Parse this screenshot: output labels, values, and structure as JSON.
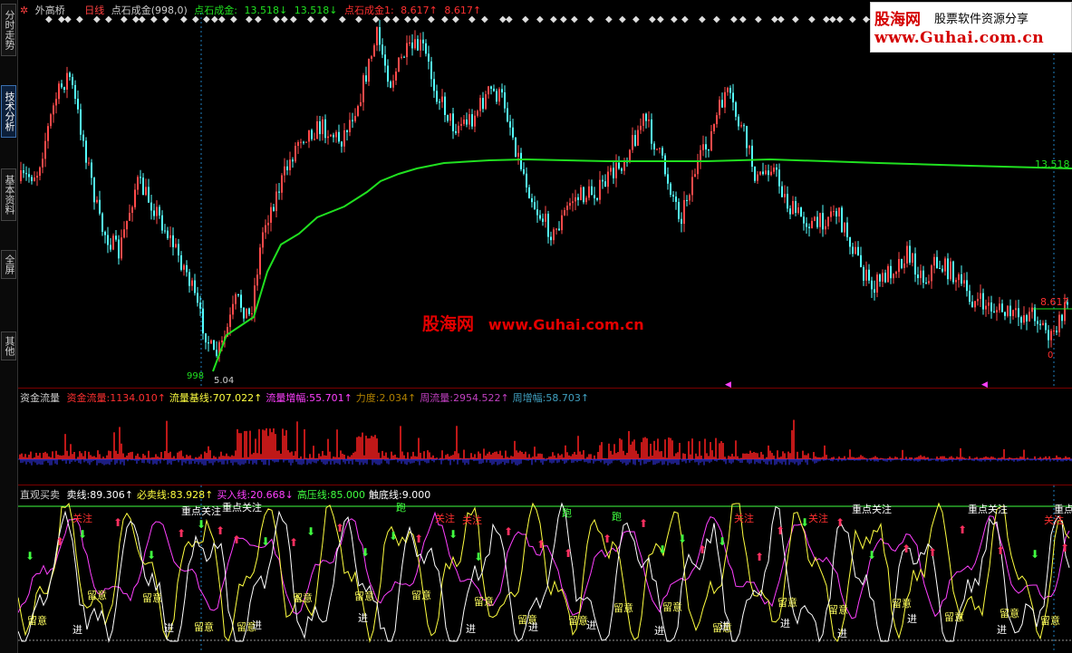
{
  "sidebar": {
    "tabs": [
      {
        "label": "分时走势"
      },
      {
        "label": "技术分析"
      },
      {
        "label": "基本资料"
      },
      {
        "label": "全屏"
      },
      {
        "label": "其他"
      }
    ]
  },
  "main_pane": {
    "stock_name": "外高桥",
    "period": "日线",
    "indicator": "点石成金(998,0)",
    "line1_label": "点石成金:",
    "line1_value": "13.518↓",
    "line1_value2": "13.518↓",
    "line2_label": "点石成金1:",
    "line2_value": "8.617↑",
    "line2_value2": "8.617↑",
    "right_label_ma": "13.518",
    "right_label_low": "8.617",
    "low_point_label": "5.04",
    "low_point_tag": "998",
    "right_zero": "0"
  },
  "flow_pane": {
    "title": "资金流量",
    "items": [
      {
        "label": "资金流量:",
        "value": "1134.010↑",
        "color": "#ff3030"
      },
      {
        "label": "流量基线:",
        "value": "707.022↑",
        "color": "#ffff40"
      },
      {
        "label": "流量增幅:",
        "value": "55.701↑",
        "color": "#ff40ff"
      },
      {
        "label": "力度:",
        "value": "2.034↑",
        "color": "#b08000"
      },
      {
        "label": "周流量:",
        "value": "2954.522↑",
        "color": "#c040c0"
      },
      {
        "label": "周增幅:",
        "value": "58.703↑",
        "color": "#40a0c0"
      }
    ]
  },
  "trade_pane": {
    "title": "直观买卖",
    "items": [
      {
        "label": "卖线:",
        "value": "89.306↑",
        "color": "#ffffff"
      },
      {
        "label": "必卖线:",
        "value": "83.928↑",
        "color": "#ffff40"
      },
      {
        "label": "买入线:",
        "value": "20.668↓",
        "color": "#ff40ff"
      },
      {
        "label": "高压线:",
        "value": "85.000",
        "color": "#40ff40"
      },
      {
        "label": "触底线:",
        "value": "9.000",
        "color": "#ffffff"
      }
    ],
    "tag_focus": "重点关注",
    "tag_attention": "关注",
    "tag_watch": "留意",
    "tag_enter": "进",
    "tag_run": "跑"
  },
  "watermark": {
    "brand": "股海网",
    "slogan": "股票软件资源分享",
    "url": "www.Guhai.com.cn",
    "center_cn": "股海网",
    "center_url": "www.Guhai.com.cn"
  },
  "colors": {
    "up": "#ff4a4a",
    "down": "#54ffff",
    "ma": "#20e020",
    "sell": "#ffffff",
    "must_sell": "#ffff40",
    "buy": "#ff40ff",
    "high": "#40ff40",
    "grid": "#7a0000"
  }
}
